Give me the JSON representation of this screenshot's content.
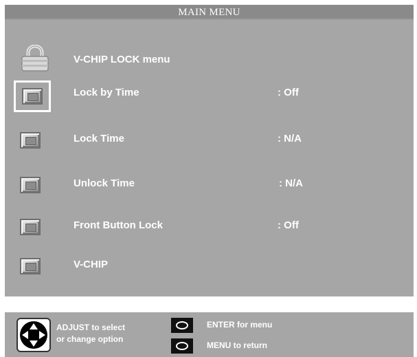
{
  "menu": {
    "title": "MAIN MENU",
    "header": "V-CHIP LOCK menu",
    "items": [
      {
        "label": "Lock by Time",
        "value": ":  Off",
        "selected": true
      },
      {
        "label": "Lock Time",
        "value": ":  N/A",
        "selected": false
      },
      {
        "label": "Unlock Time",
        "value": ":  N/A",
        "selected": false
      },
      {
        "label": "Front Button Lock",
        "value": ":  Off",
        "selected": false
      },
      {
        "label": "V-CHIP",
        "value": "",
        "selected": false
      }
    ]
  },
  "footer": {
    "adjust_line1": "ADJUST to select",
    "adjust_line2": "or  change  option",
    "enter": "ENTER for menu",
    "return": "MENU to return"
  },
  "icons": {
    "lock": "padlock-icon",
    "item": "square-button-icon",
    "dpad": "directional-pad-icon",
    "oval": "oval-button-icon"
  },
  "colors": {
    "panel": "#a6a6a6",
    "title_bar": "#8a8a8a",
    "text": "#ffffff"
  }
}
